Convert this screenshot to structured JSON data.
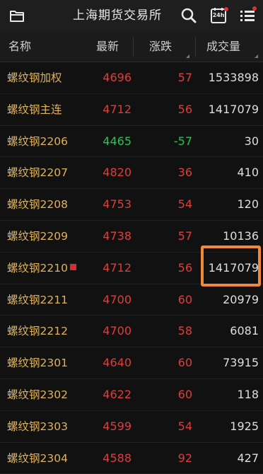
{
  "header": {
    "title": "上海期货交易所",
    "calendar_label": "24h"
  },
  "columns": {
    "name": "名称",
    "latest": "最新",
    "change": "涨跌",
    "volume": "成交量"
  },
  "colors": {
    "up": "#e23b3b",
    "down": "#29c24a",
    "name": "#e0b25a",
    "highlight": "#f0883a"
  },
  "rows": [
    {
      "name": "螺纹钢加权",
      "latest": "4696",
      "change": "57",
      "volume": "1533898",
      "dir": "up"
    },
    {
      "name": "螺纹钢主连",
      "latest": "4712",
      "change": "56",
      "volume": "1417079",
      "dir": "up"
    },
    {
      "name": "螺纹钢2206",
      "latest": "4465",
      "change": "-57",
      "volume": "30",
      "dir": "down"
    },
    {
      "name": "螺纹钢2207",
      "latest": "4820",
      "change": "36",
      "volume": "410",
      "dir": "up"
    },
    {
      "name": "螺纹钢2208",
      "latest": "4753",
      "change": "54",
      "volume": "120",
      "dir": "up"
    },
    {
      "name": "螺纹钢2209",
      "latest": "4738",
      "change": "57",
      "volume": "10136",
      "dir": "up"
    },
    {
      "name": "螺纹钢2210",
      "latest": "4712",
      "change": "56",
      "volume": "1417079",
      "dir": "up",
      "main": true
    },
    {
      "name": "螺纹钢2211",
      "latest": "4700",
      "change": "60",
      "volume": "20979",
      "dir": "up"
    },
    {
      "name": "螺纹钢2212",
      "latest": "4700",
      "change": "58",
      "volume": "6081",
      "dir": "up"
    },
    {
      "name": "螺纹钢2301",
      "latest": "4640",
      "change": "60",
      "volume": "73915",
      "dir": "up"
    },
    {
      "name": "螺纹钢2302",
      "latest": "4622",
      "change": "60",
      "volume": "118",
      "dir": "up"
    },
    {
      "name": "螺纹钢2303",
      "latest": "4599",
      "change": "54",
      "volume": "1925",
      "dir": "up"
    },
    {
      "name": "螺纹钢2304",
      "latest": "4588",
      "change": "92",
      "volume": "427",
      "dir": "up"
    }
  ]
}
